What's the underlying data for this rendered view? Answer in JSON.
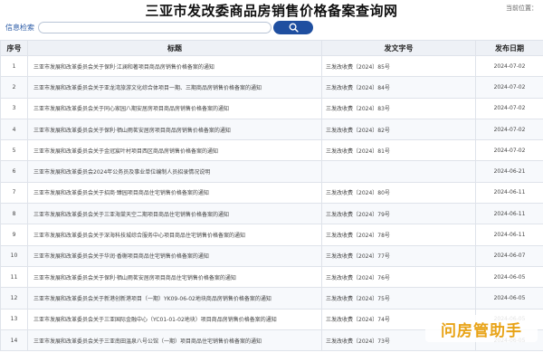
{
  "header": {
    "title": "三亚市发改委商品房销售价格备案查询网",
    "location_label": "当前位置："
  },
  "search": {
    "label": "信息检索",
    "value": "",
    "placeholder": ""
  },
  "table": {
    "columns": [
      "序号",
      "标题",
      "发文字号",
      "发布日期"
    ],
    "rows": [
      {
        "no": "1",
        "title": "三亚市发展和改革委员会关于保利·江澜和著项目商品房销售价格备案的通知",
        "doc": "三发改收费〔2024〕85号",
        "date": "2024-07-02"
      },
      {
        "no": "2",
        "title": "三亚市发展和改革委员会关于亚龙湾旅游文化综合体项目一期、三期商品房销售价格备案的通知",
        "doc": "三发改收费〔2024〕84号",
        "date": "2024-07-02"
      },
      {
        "no": "3",
        "title": "三亚市发展和改革委员会关于同心家园八期安居房项目商品房销售价格备案的通知",
        "doc": "三发改收费〔2024〕83号",
        "date": "2024-07-02"
      },
      {
        "no": "4",
        "title": "三亚市发展和改革委员会关于保利·栖山雨茗安居房项目商品房销售价格备案的通知",
        "doc": "三发改收费〔2024〕82号",
        "date": "2024-07-02"
      },
      {
        "no": "5",
        "title": "三亚市发展和改革委员会关于金冠宸叶村项目西区商品房销售价格备案的通知",
        "doc": "三发改收费〔2024〕81号",
        "date": "2024-07-02"
      },
      {
        "no": "6",
        "title": "三亚市发展和改革委员会2024年公务员及事业单位编制人员招录情况说明",
        "doc": "",
        "date": "2024-06-21"
      },
      {
        "no": "7",
        "title": "三亚市发展和改革委员会关于招商·臻园项目商品住宅销售价格备案的通知",
        "doc": "三发改收费〔2024〕80号",
        "date": "2024-06-11"
      },
      {
        "no": "8",
        "title": "三亚市发展和改革委员会关于三亚海棠天空二期项目商品住宅销售价格备案的通知",
        "doc": "三发改收费〔2024〕79号",
        "date": "2024-06-11"
      },
      {
        "no": "9",
        "title": "三亚市发展和改革委员会关于深海科技城综合服务中心项目商品住宅销售价格备案的通知",
        "doc": "三发改收费〔2024〕78号",
        "date": "2024-06-11"
      },
      {
        "no": "10",
        "title": "三亚市发展和改革委员会关于华润·香榭项目商品住宅销售价格备案的通知",
        "doc": "三发改收费〔2024〕77号",
        "date": "2024-06-07"
      },
      {
        "no": "11",
        "title": "三亚市发展和改革委员会关于保利·栖山雨茗安居房项目商品住宅销售价格备案的通知",
        "doc": "三发改收费〔2024〕76号",
        "date": "2024-06-05"
      },
      {
        "no": "12",
        "title": "三亚市发展和改革委员会关于新港创新港项目（一期）YK09-06-02地块商品房销售价格备案的通知",
        "doc": "三发改收费〔2024〕75号",
        "date": "2024-06-05"
      },
      {
        "no": "13",
        "title": "三亚市发展和改革委员会关于三亚国际金融中心（YC01-01-02地块）项目商品房销售价格备案的通知",
        "doc": "三发改收费〔2024〕74号",
        "date": "2024-06-05"
      },
      {
        "no": "14",
        "title": "三亚市发展和改革委员会关于三亚南田温泉八号公馆（一期）项目商品住宅销售价格备案的通知",
        "doc": "三发改收费〔2024〕73号",
        "date": "2024-06-05"
      }
    ]
  },
  "watermark": {
    "text": "问房管助手"
  },
  "colors": {
    "accent": "#1f4fa0",
    "link": "#2a5aa6",
    "watermark": "#e8a317"
  }
}
